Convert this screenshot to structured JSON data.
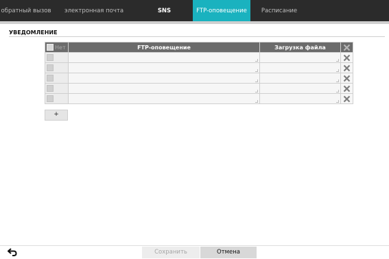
{
  "tabs": [
    {
      "label": "обратный вызов",
      "bold": false,
      "active": false
    },
    {
      "label": "электронная почта",
      "bold": false,
      "active": false
    },
    {
      "label": "SNS",
      "bold": true,
      "active": false
    },
    {
      "label": "FTP-оповещение",
      "bold": false,
      "active": true
    },
    {
      "label": "Расписание",
      "bold": false,
      "active": false
    }
  ],
  "section": {
    "title": "УВЕДОМЛЕНИЕ"
  },
  "table": {
    "headers": {
      "check": "Нет",
      "ftp": "FTP-оповещение",
      "file": "Загрузка файла"
    },
    "rows": [
      {
        "checked": false,
        "ftp": "",
        "file": ""
      },
      {
        "checked": false,
        "ftp": "",
        "file": ""
      },
      {
        "checked": false,
        "ftp": "",
        "file": ""
      },
      {
        "checked": false,
        "ftp": "",
        "file": ""
      },
      {
        "checked": false,
        "ftp": "",
        "file": ""
      }
    ]
  },
  "buttons": {
    "add": "+",
    "save": "Сохранить",
    "cancel": "Отмена"
  },
  "colors": {
    "tabbar": "#2b2b2b",
    "active_tab": "#1ab2bf",
    "header": "#6b6b6b"
  }
}
